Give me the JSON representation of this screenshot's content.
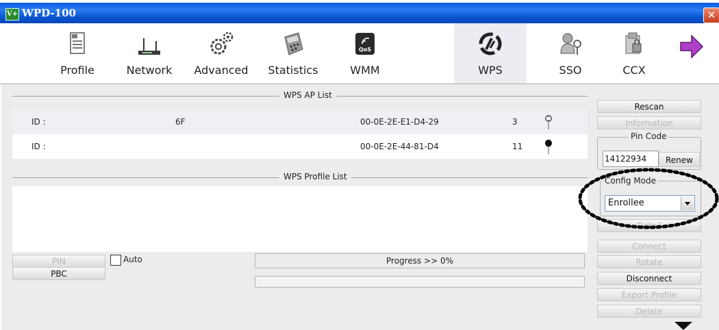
{
  "window": {
    "title": "WPD-100",
    "app_icon": "V+",
    "close_glyph": "✕"
  },
  "toolbar": {
    "items": [
      {
        "label": "Profile",
        "icon": "profile-icon",
        "active": false
      },
      {
        "label": "Network",
        "icon": "router-icon",
        "active": false
      },
      {
        "label": "Advanced",
        "icon": "gears-icon",
        "active": false
      },
      {
        "label": "Statistics",
        "icon": "calculator-icon",
        "active": false
      },
      {
        "label": "WMM",
        "icon": "qos-icon",
        "active": false
      },
      {
        "label": "WPS",
        "icon": "wps-icon",
        "active": true
      },
      {
        "label": "SSO",
        "icon": "user-key-icon",
        "active": false
      },
      {
        "label": "CCX",
        "icon": "ccx-icon",
        "active": false
      }
    ]
  },
  "wps_ap_list": {
    "title": "WPS AP List",
    "rows": [
      {
        "id_label": "ID :",
        "ssid": "6F",
        "bssid": "00-0E-2E-E1-D4-29",
        "channel": "3",
        "icon": "key-icon"
      },
      {
        "id_label": "ID :",
        "ssid": "",
        "bssid": "00-0E-2E-44-81-D4",
        "channel": "11",
        "icon": "key-icon"
      }
    ]
  },
  "wps_profile_list": {
    "title": "WPS Profile List"
  },
  "bottom": {
    "pin_label": "PIN",
    "pbc_label": "PBC",
    "auto_label": "Auto",
    "progress_text": "Progress >> 0%",
    "progress_value": 0
  },
  "side": {
    "rescan": "Rescan",
    "information": "Information",
    "pin_code_title": "Pin Code",
    "pin_code_value": "14122934",
    "renew": "Renew",
    "config_mode_title": "Config Mode",
    "config_mode_value": "Enrollee",
    "detail": "Detail",
    "connect": "Connect",
    "rotate": "Rotate",
    "disconnect": "Disconnect",
    "export_profile": "Export Profile",
    "delete": "Delete"
  },
  "colors": {
    "titlebar": "#0a5fe0",
    "panel": "#ececec",
    "active_tab": "#ecedf2"
  }
}
